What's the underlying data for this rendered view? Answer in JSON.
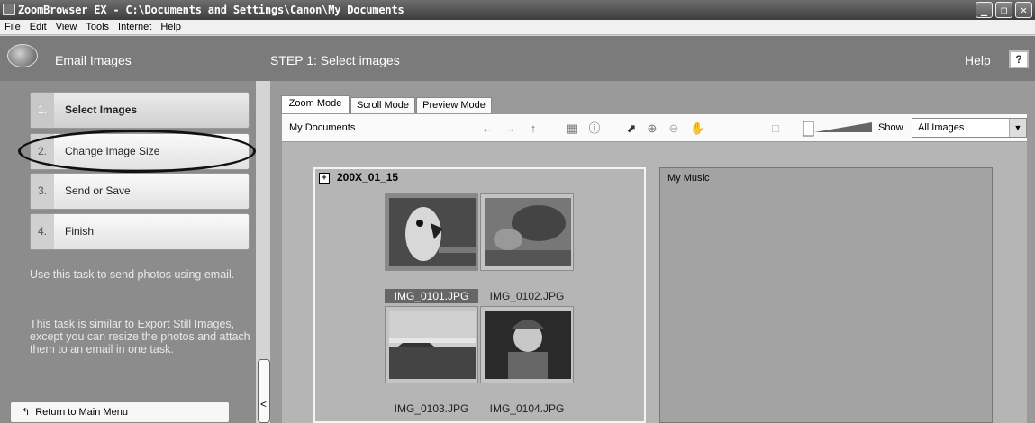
{
  "window": {
    "title": "ZoomBrowser EX  -  C:\\Documents and Settings\\Canon\\My Documents"
  },
  "menu": [
    "File",
    "Edit",
    "View",
    "Tools",
    "Internet",
    "Help"
  ],
  "header": {
    "task_title": "Email Images",
    "step_title": "STEP 1: Select images",
    "help_label": "Help",
    "help_button": "?"
  },
  "steps": [
    {
      "num": "1.",
      "label": "Select Images",
      "state": "active"
    },
    {
      "num": "2.",
      "label": "Change Image Size",
      "state": "circled"
    },
    {
      "num": "3.",
      "label": "Send or Save",
      "state": "normal"
    },
    {
      "num": "4.",
      "label": "Finish",
      "state": "normal"
    }
  ],
  "info": {
    "p1": "Use this task to send photos using email.",
    "p2": "This task is similar to Export Still Images, except you can resize the photos and attach them to an email in one task."
  },
  "return_button": "Return to Main Menu",
  "collapse_glyph": "<",
  "tabs": [
    "Zoom Mode",
    "Scroll Mode",
    "Preview Mode"
  ],
  "toolbar": {
    "path": "My Documents",
    "show_label": "Show",
    "show_value": "All Images"
  },
  "folders": [
    {
      "name": "200X_01_15",
      "expand_glyph": "+"
    },
    {
      "name": "My Music"
    }
  ],
  "images": [
    {
      "name": "IMG_0101.JPG",
      "selected": true
    },
    {
      "name": "IMG_0102.JPG",
      "selected": false
    },
    {
      "name": "IMG_0103.JPG",
      "selected": false
    },
    {
      "name": "IMG_0104.JPG",
      "selected": false
    }
  ]
}
